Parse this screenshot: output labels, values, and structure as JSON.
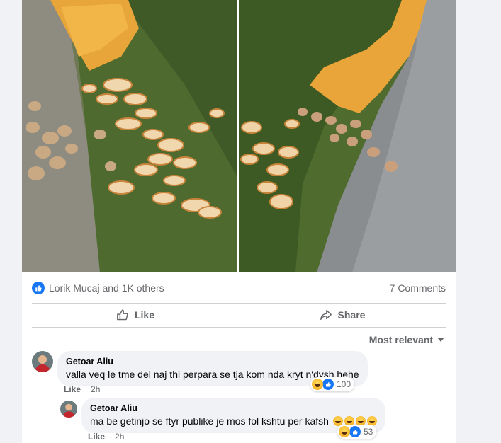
{
  "post": {
    "reaction_summary": "Lorik Mucaj and 1K others",
    "comments_count": "7 Comments"
  },
  "actions": {
    "like_label": "Like",
    "share_label": "Share"
  },
  "comments_section": {
    "sort_label": "Most relevant"
  },
  "comments": [
    {
      "author": "Getoar Aliu",
      "text": "valla veq le tme del naj thi perpara se tja kom nda kryt n'dysh hehe",
      "like_label": "Like",
      "time": "2h",
      "reaction_count": "100"
    },
    {
      "author": "Getoar Aliu",
      "text": "ma be getinjo se ftyr publike je mos fol kshtu per kafsh",
      "like_label": "Like",
      "time": "2h",
      "reaction_count": "53"
    }
  ],
  "colors": {
    "accent": "#1877f2",
    "muted_text": "#65676b",
    "bubble": "#f0f2f5"
  },
  "icons": [
    "like-reaction-icon",
    "thumbs-up-icon",
    "share-arrow-icon",
    "caret-down-icon",
    "laugh-emoji-icon"
  ]
}
